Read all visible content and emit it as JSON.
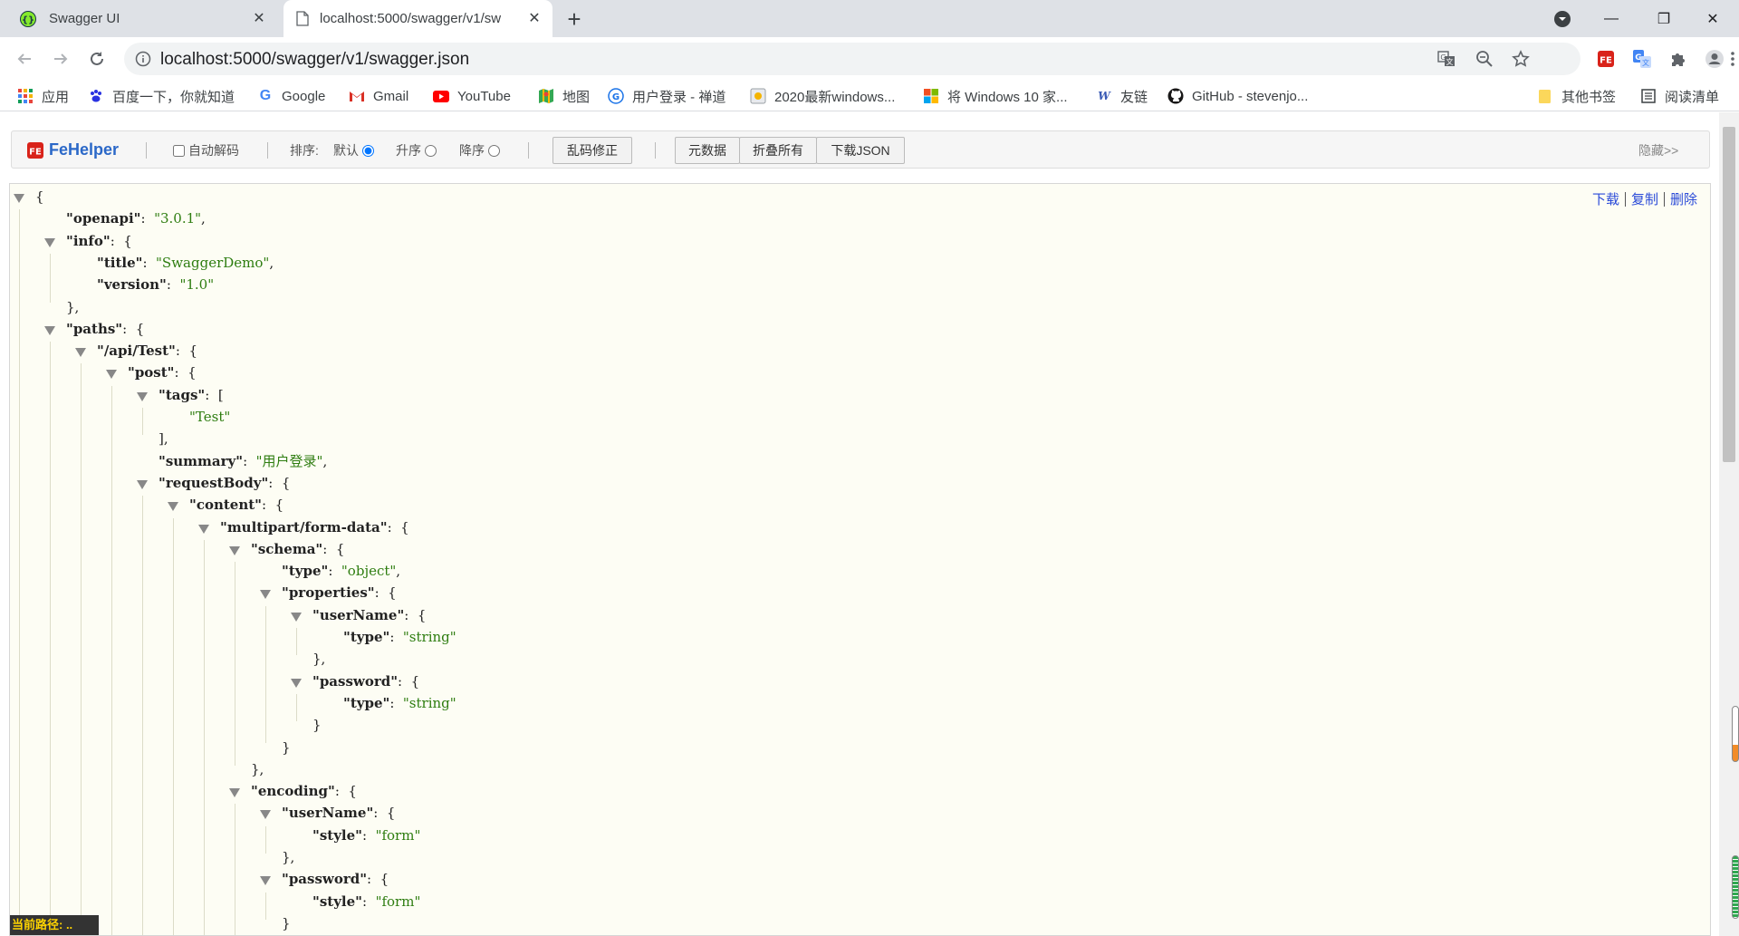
{
  "tabs": [
    {
      "title": "Swagger UI",
      "icon": "swagger-icon"
    },
    {
      "title": "localhost:5000/swagger/v1/sw",
      "icon": "document-icon"
    }
  ],
  "new_tab": "+",
  "window": {
    "minimize": "—",
    "restore": "❐",
    "close": "✕",
    "profile": "profile-menu-icon"
  },
  "address": {
    "url": "localhost:5000/swagger/v1/swagger.json"
  },
  "bookmarks": [
    {
      "label": "应用",
      "icon": "apps-grid-icon"
    },
    {
      "label": "百度一下，你就知道",
      "icon": "baidu-paw-icon"
    },
    {
      "label": "Google",
      "icon": "google-icon"
    },
    {
      "label": "Gmail",
      "icon": "gmail-icon"
    },
    {
      "label": "YouTube",
      "icon": "youtube-icon"
    },
    {
      "label": "地图",
      "icon": "map-icon"
    },
    {
      "label": "用户登录 - 禅道",
      "icon": "zentao-icon"
    },
    {
      "label": "2020最新windows...",
      "icon": "page-icon"
    },
    {
      "label": "将 Windows 10 家...",
      "icon": "windows-icon"
    },
    {
      "label": "友链",
      "icon": "link-w-icon"
    },
    {
      "label": "GitHub - stevenjo...",
      "icon": "github-icon"
    },
    {
      "label": "其他书签",
      "icon": "folder-icon"
    },
    {
      "label": "阅读清单",
      "icon": "reading-list-icon"
    }
  ],
  "fehelper": {
    "logo_text": "FeHelper",
    "auto_decode": "自动解码",
    "sort_label": "排序:",
    "sort_default": "默认",
    "sort_asc": "升序",
    "sort_desc": "降序",
    "fix_garbled": "乱码修正",
    "metadata": "元数据",
    "collapse_all": "折叠所有",
    "download_json": "下载JSON",
    "hide": "隐藏>>"
  },
  "json_actions": {
    "download": "下载",
    "copy": "复制",
    "delete": "删除"
  },
  "json_lines": [
    {
      "indent": 0,
      "toggle": true,
      "key": null,
      "value": "{",
      "type": "p",
      "tail": ""
    },
    {
      "indent": 1,
      "toggle": false,
      "key": "openapi",
      "value": "\"3.0.1\"",
      "type": "s",
      "tail": ","
    },
    {
      "indent": 1,
      "toggle": true,
      "key": "info",
      "value": "{",
      "type": "p",
      "tail": ""
    },
    {
      "indent": 2,
      "toggle": false,
      "key": "title",
      "value": "\"SwaggerDemo\"",
      "type": "s",
      "tail": ","
    },
    {
      "indent": 2,
      "toggle": false,
      "key": "version",
      "value": "\"1.0\"",
      "type": "s",
      "tail": ""
    },
    {
      "indent": 1,
      "toggle": false,
      "key": null,
      "value": "},",
      "type": "p",
      "tail": ""
    },
    {
      "indent": 1,
      "toggle": true,
      "key": "paths",
      "value": "{",
      "type": "p",
      "tail": ""
    },
    {
      "indent": 2,
      "toggle": true,
      "key": "/api/Test",
      "value": "{",
      "type": "p",
      "tail": ""
    },
    {
      "indent": 3,
      "toggle": true,
      "key": "post",
      "value": "{",
      "type": "p",
      "tail": ""
    },
    {
      "indent": 4,
      "toggle": true,
      "key": "tags",
      "value": "[",
      "type": "p",
      "tail": ""
    },
    {
      "indent": 5,
      "toggle": false,
      "key": null,
      "value": "\"Test\"",
      "type": "s",
      "tail": ""
    },
    {
      "indent": 4,
      "toggle": false,
      "key": null,
      "value": "],",
      "type": "p",
      "tail": ""
    },
    {
      "indent": 4,
      "toggle": false,
      "key": "summary",
      "value": "\"用户登录\"",
      "type": "s",
      "tail": ","
    },
    {
      "indent": 4,
      "toggle": true,
      "key": "requestBody",
      "value": "{",
      "type": "p",
      "tail": ""
    },
    {
      "indent": 5,
      "toggle": true,
      "key": "content",
      "value": "{",
      "type": "p",
      "tail": ""
    },
    {
      "indent": 6,
      "toggle": true,
      "key": "multipart/form-data",
      "value": "{",
      "type": "p",
      "tail": ""
    },
    {
      "indent": 7,
      "toggle": true,
      "key": "schema",
      "value": "{",
      "type": "p",
      "tail": ""
    },
    {
      "indent": 8,
      "toggle": false,
      "key": "type",
      "value": "\"object\"",
      "type": "s",
      "tail": ","
    },
    {
      "indent": 8,
      "toggle": true,
      "key": "properties",
      "value": "{",
      "type": "p",
      "tail": ""
    },
    {
      "indent": 9,
      "toggle": true,
      "key": "userName",
      "value": "{",
      "type": "p",
      "tail": ""
    },
    {
      "indent": 10,
      "toggle": false,
      "key": "type",
      "value": "\"string\"",
      "type": "s",
      "tail": ""
    },
    {
      "indent": 9,
      "toggle": false,
      "key": null,
      "value": "},",
      "type": "p",
      "tail": ""
    },
    {
      "indent": 9,
      "toggle": true,
      "key": "password",
      "value": "{",
      "type": "p",
      "tail": ""
    },
    {
      "indent": 10,
      "toggle": false,
      "key": "type",
      "value": "\"string\"",
      "type": "s",
      "tail": ""
    },
    {
      "indent": 9,
      "toggle": false,
      "key": null,
      "value": "}",
      "type": "p",
      "tail": ""
    },
    {
      "indent": 8,
      "toggle": false,
      "key": null,
      "value": "}",
      "type": "p",
      "tail": ""
    },
    {
      "indent": 7,
      "toggle": false,
      "key": null,
      "value": "},",
      "type": "p",
      "tail": ""
    },
    {
      "indent": 7,
      "toggle": true,
      "key": "encoding",
      "value": "{",
      "type": "p",
      "tail": ""
    },
    {
      "indent": 8,
      "toggle": true,
      "key": "userName",
      "value": "{",
      "type": "p",
      "tail": ""
    },
    {
      "indent": 9,
      "toggle": false,
      "key": "style",
      "value": "\"form\"",
      "type": "s",
      "tail": ""
    },
    {
      "indent": 8,
      "toggle": false,
      "key": null,
      "value": "},",
      "type": "p",
      "tail": ""
    },
    {
      "indent": 8,
      "toggle": true,
      "key": "password",
      "value": "{",
      "type": "p",
      "tail": ""
    },
    {
      "indent": 9,
      "toggle": false,
      "key": "style",
      "value": "\"form\"",
      "type": "s",
      "tail": ""
    },
    {
      "indent": 8,
      "toggle": false,
      "key": null,
      "value": "}",
      "type": "p",
      "tail": ""
    },
    {
      "indent": 7,
      "toggle": false,
      "key": null,
      "value": "}",
      "type": "p",
      "tail": ""
    }
  ],
  "path_bar": "当前路径: ..",
  "colors": {
    "key": "#222222",
    "string": "#2e7d10",
    "link": "#2b4bd8",
    "json_bg": "#fdfdf4"
  }
}
